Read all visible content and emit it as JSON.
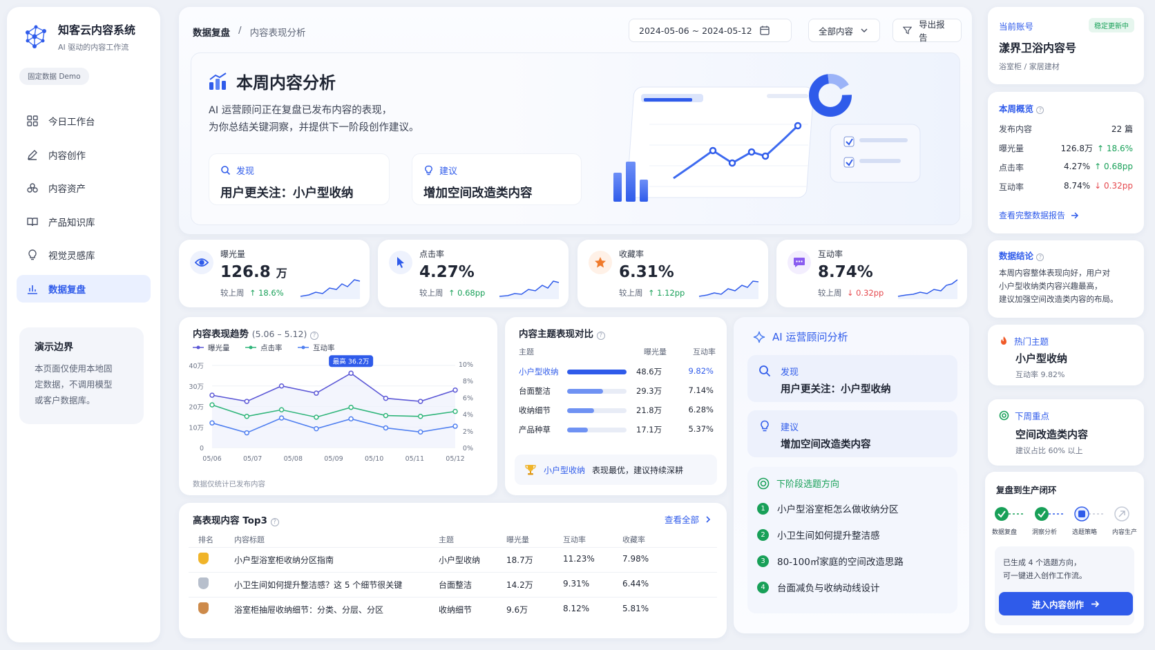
{
  "app": {
    "name": "知客云内容系统",
    "tagline": "AI 驱动的内容工作流",
    "demo_tag": "固定数据 Demo"
  },
  "nav": [
    {
      "label": "今日工作台",
      "icon": "grid-icon"
    },
    {
      "label": "内容创作",
      "icon": "pen-icon"
    },
    {
      "label": "内容资产",
      "icon": "assets-icon"
    },
    {
      "label": "产品知识库",
      "icon": "book-icon"
    },
    {
      "label": "视觉灵感库",
      "icon": "bulb-icon"
    },
    {
      "label": "数据复盘",
      "icon": "bar-chart-icon",
      "active": true
    }
  ],
  "boundary": {
    "title": "演示边界",
    "line1": "本页面仅使用本地固",
    "line2": "定数据，不调用模型",
    "line3": "或客户数据库。"
  },
  "header": {
    "crumb_root": "数据复盘",
    "crumb_sep": "/",
    "crumb_page": "内容表现分析",
    "date_range": "2024-05-06 ~ 2024-05-12",
    "filter": "全部内容",
    "export": "导出报告"
  },
  "hero": {
    "title": "本周内容分析",
    "desc1": "AI 运营顾问正在复盘已发布内容的表现，",
    "desc2": "为你总结关键洞察，并提供下一阶段创作建议。",
    "find_label": "发现",
    "find_text": "用户更关注：小户型收纳",
    "suggest_label": "建议",
    "suggest_text": "增加空间改造类内容"
  },
  "kpis": [
    {
      "label": "曝光量",
      "value": "126.8",
      "unit": "万",
      "cmp": "较上周",
      "delta": "↑ 18.6%",
      "dir": "up",
      "color": "#2f5bea",
      "icon": "eye-icon"
    },
    {
      "label": "点击率",
      "value": "4.27%",
      "unit": "",
      "cmp": "较上周",
      "delta": "↑ 0.68pp",
      "dir": "up",
      "color": "#2f5bea",
      "icon": "cursor-icon"
    },
    {
      "label": "收藏率",
      "value": "6.31%",
      "unit": "",
      "cmp": "较上周",
      "delta": "↑ 1.12pp",
      "dir": "up",
      "color": "#f07a2b",
      "icon": "star-icon"
    },
    {
      "label": "互动率",
      "value": "8.74%",
      "unit": "",
      "cmp": "较上周",
      "delta": "↓ 0.32pp",
      "dir": "down",
      "color": "#8a5cf0",
      "icon": "chat-icon"
    }
  ],
  "trend": {
    "title": "内容表现趋势",
    "range": "(5.06 – 5.12)",
    "footnote": "数据仅统计已发布内容",
    "peak_label": "最高 36.2万"
  },
  "chart_data": {
    "type": "line",
    "x": [
      "05/06",
      "05/07",
      "05/08",
      "05/09",
      "05/10",
      "05/11",
      "05/12"
    ],
    "yticks_left": [
      "40万",
      "30万",
      "20万",
      "10万",
      "0"
    ],
    "yticks_right": [
      "10%",
      "8%",
      "6%",
      "4%",
      "2%",
      "0%"
    ],
    "ylim_left": [
      0,
      40
    ],
    "ylim_right": [
      0,
      10
    ],
    "series": [
      {
        "name": "曝光量",
        "axis": "left",
        "color": "#5b57d6",
        "values": [
          25.5,
          22.5,
          30,
          26.5,
          36.2,
          24,
          22.5,
          28
        ]
      },
      {
        "name": "点击率",
        "axis": "right",
        "color": "#2fb57a",
        "values": [
          5.2,
          3.8,
          4.6,
          3.7,
          4.9,
          3.9,
          3.8,
          4.4
        ]
      },
      {
        "name": "互动率",
        "axis": "right",
        "color": "#4f7ff0",
        "values": [
          3.0,
          1.8,
          3.6,
          2.3,
          3.5,
          2.4,
          1.9,
          2.6
        ]
      }
    ]
  },
  "topic": {
    "title": "内容主题表现对比",
    "h_topic": "主题",
    "h_exp": "曝光量",
    "h_rate": "互动率",
    "rows": [
      {
        "name": "小户型收纳",
        "exp": "48.6万",
        "rate": "9.82%",
        "frac": 1.0,
        "hl": true
      },
      {
        "name": "台面整洁",
        "exp": "29.3万",
        "rate": "7.14%",
        "frac": 0.6,
        "hl": false
      },
      {
        "name": "收纳细节",
        "exp": "21.8万",
        "rate": "6.28%",
        "frac": 0.45,
        "hl": false
      },
      {
        "name": "产品种草",
        "exp": "17.1万",
        "rate": "5.37%",
        "frac": 0.35,
        "hl": false
      }
    ],
    "best_name": "小户型收纳",
    "best_text": "表现最优，建议持续深耕"
  },
  "top3": {
    "title": "高表现内容 Top3",
    "view_all": "查看全部",
    "headers": [
      "排名",
      "内容标题",
      "主题",
      "曝光量",
      "互动率",
      "收藏率"
    ],
    "rows": [
      {
        "title": "小户型浴室柜收纳分区指南",
        "topic": "小户型收纳",
        "exp": "18.7万",
        "rate": "11.23%",
        "fav": "7.98%"
      },
      {
        "title": "小卫生间如何提升整洁感？这 5 个细节很关键",
        "topic": "台面整洁",
        "exp": "14.2万",
        "rate": "9.31%",
        "fav": "6.44%"
      },
      {
        "title": "浴室柜抽屉收纳细节：分类、分层、分区",
        "topic": "收纳细节",
        "exp": "9.6万",
        "rate": "8.12%",
        "fav": "5.81%"
      }
    ]
  },
  "ai": {
    "title": "AI 运营顾问分析",
    "find_label": "发现",
    "find_text": "用户更关注：小户型收纳",
    "suggest_label": "建议",
    "suggest_text": "增加空间改造类内容",
    "next_title": "下阶段选题方向",
    "next": [
      "小户型浴室柜怎么做收纳分区",
      "小卫生间如何提升整洁感",
      "80-100㎡家庭的空间改造思路",
      "台面减负与收纳动线设计"
    ]
  },
  "account": {
    "label": "当前账号",
    "badge": "稳定更新中",
    "name": "漾界卫浴内容号",
    "category": "浴室柜 / 家居建材"
  },
  "week": {
    "title": "本周概览",
    "rows": [
      {
        "k": "发布内容",
        "v": "22 篇",
        "d": "",
        "dir": ""
      },
      {
        "k": "曝光量",
        "v": "126.8万",
        "d": "↑ 18.6%",
        "dir": "up"
      },
      {
        "k": "点击率",
        "v": "4.27%",
        "d": "↑ 0.68pp",
        "dir": "up"
      },
      {
        "k": "互动率",
        "v": "8.74%",
        "d": "↓ 0.32pp",
        "dir": "down"
      }
    ],
    "link": "查看完整数据报告"
  },
  "conclusion": {
    "title": "数据结论",
    "l1": "本周内容整体表现向好，用户对",
    "l2": "小户型收纳类内容兴趣最高，",
    "l3": "建议加强空间改造类内容的布局。"
  },
  "hot": {
    "label": "热门主题",
    "name": "小户型收纳",
    "sub": "互动率 9.82%"
  },
  "next_week": {
    "label": "下周重点",
    "name": "空间改造类内容",
    "sub": "建议占比 60% 以上"
  },
  "loop": {
    "title": "复盘到生产闭环",
    "steps": [
      "数据复盘",
      "洞察分析",
      "选题策略",
      "内容生产"
    ],
    "note1": "已生成 4 个选题方向，",
    "note2": "可一键进入创作工作流。",
    "cta": "进入内容创作"
  }
}
